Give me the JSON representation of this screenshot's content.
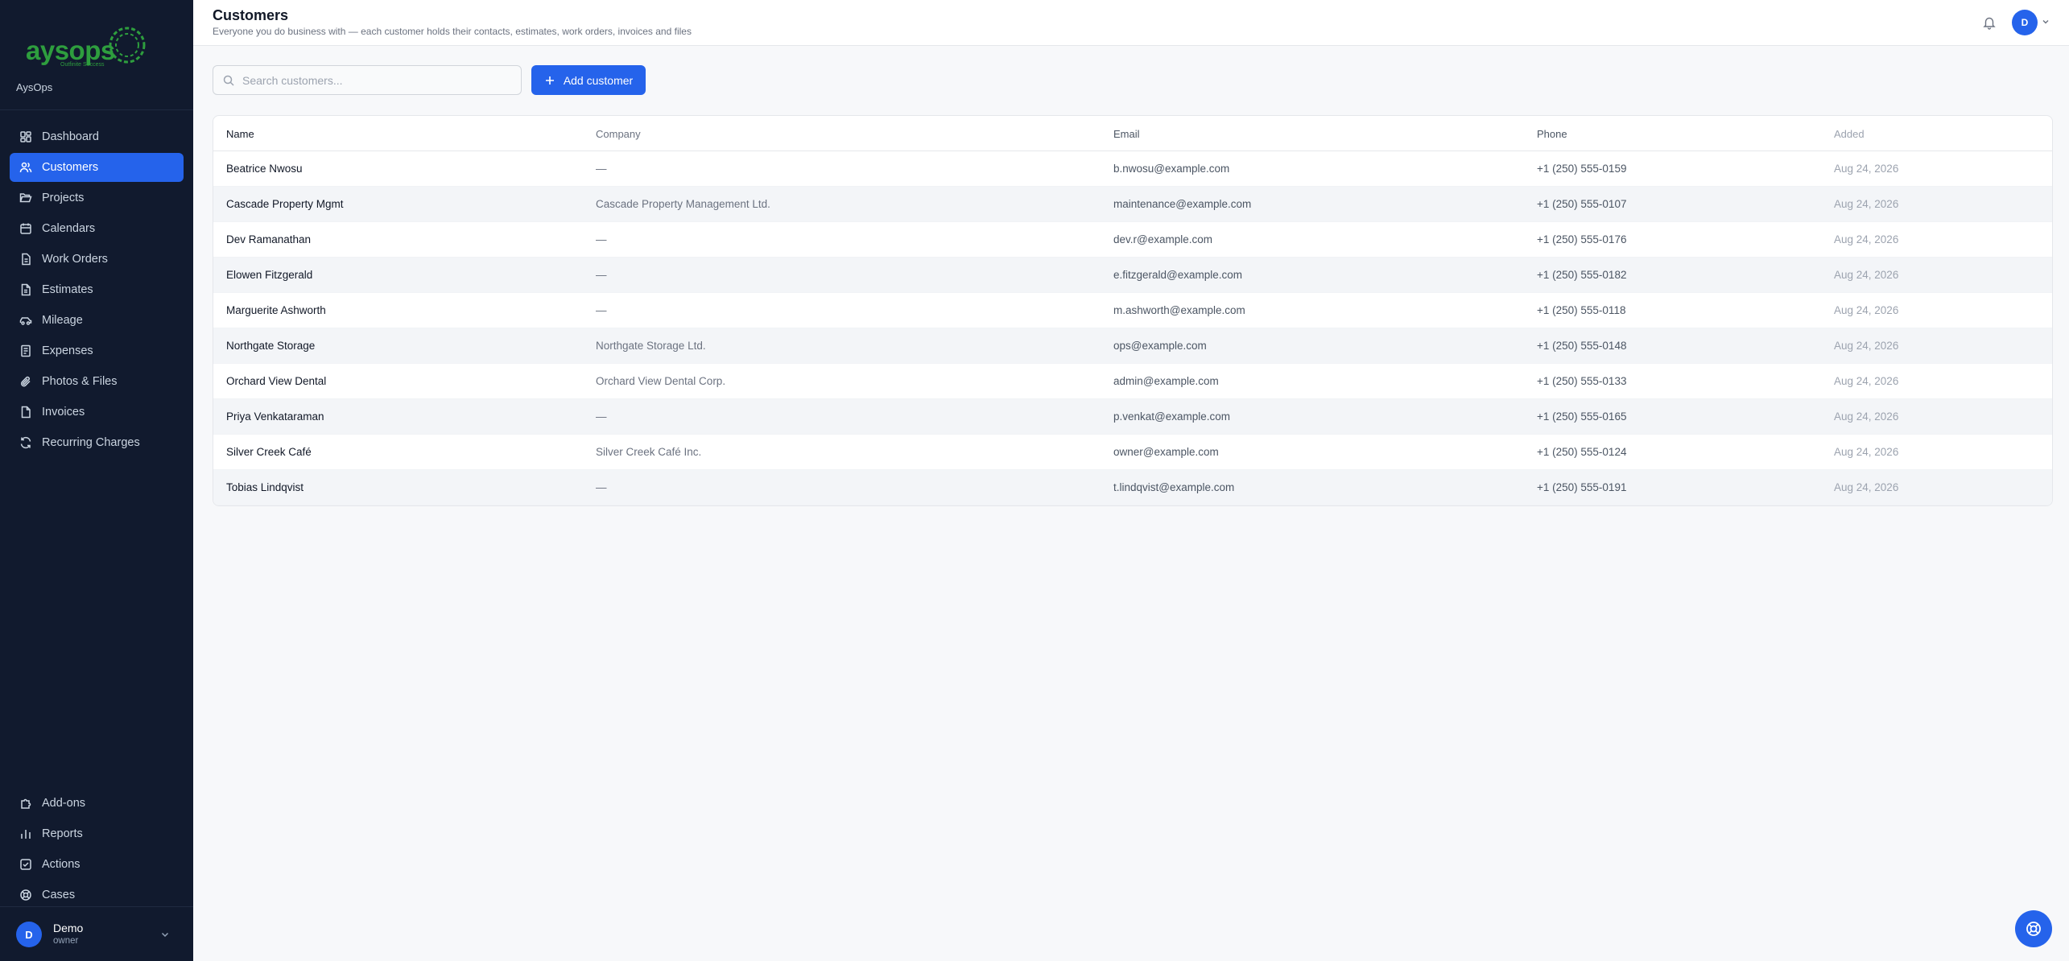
{
  "brand": {
    "logo_text": "aysops",
    "logo_tagline": "Outfinite Success",
    "org_name": "AysOps"
  },
  "sidebar": {
    "items": [
      {
        "label": "Dashboard",
        "icon": "dashboard-icon",
        "active": false
      },
      {
        "label": "Customers",
        "icon": "users-icon",
        "active": true
      },
      {
        "label": "Projects",
        "icon": "folder-icon",
        "active": false
      },
      {
        "label": "Calendars",
        "icon": "calendar-icon",
        "active": false
      },
      {
        "label": "Work Orders",
        "icon": "clipboard-icon",
        "active": false
      },
      {
        "label": "Estimates",
        "icon": "document-icon",
        "active": false
      },
      {
        "label": "Mileage",
        "icon": "car-icon",
        "active": false
      },
      {
        "label": "Expenses",
        "icon": "receipt-icon",
        "active": false
      },
      {
        "label": "Photos & Files",
        "icon": "paperclip-icon",
        "active": false
      },
      {
        "label": "Invoices",
        "icon": "invoice-icon",
        "active": false
      },
      {
        "label": "Recurring Charges",
        "icon": "refresh-icon",
        "active": false
      }
    ],
    "bottom_items": [
      {
        "label": "Add-ons",
        "icon": "puzzle-icon"
      },
      {
        "label": "Reports",
        "icon": "bar-chart-icon"
      },
      {
        "label": "Actions",
        "icon": "checkbox-icon"
      },
      {
        "label": "Cases",
        "icon": "lifebuoy-icon"
      }
    ],
    "user": {
      "initial": "D",
      "name": "Demo",
      "role": "owner"
    }
  },
  "header": {
    "title": "Customers",
    "subtitle": "Everyone you do business with — each customer holds their contacts, estimates, work orders, invoices and files",
    "avatar_initial": "D"
  },
  "toolbar": {
    "search_placeholder": "Search customers...",
    "add_label": "Add customer"
  },
  "table": {
    "columns": [
      "Name",
      "Company",
      "Email",
      "Phone",
      "Added"
    ],
    "rows": [
      {
        "name": "Beatrice Nwosu",
        "company": "—",
        "email": "b.nwosu@example.com",
        "phone": "+1 (250) 555-0159",
        "added": "Aug 24, 2026"
      },
      {
        "name": "Cascade Property Mgmt",
        "company": "Cascade Property Management Ltd.",
        "email": "maintenance@example.com",
        "phone": "+1 (250) 555-0107",
        "added": "Aug 24, 2026"
      },
      {
        "name": "Dev Ramanathan",
        "company": "—",
        "email": "dev.r@example.com",
        "phone": "+1 (250) 555-0176",
        "added": "Aug 24, 2026"
      },
      {
        "name": "Elowen Fitzgerald",
        "company": "—",
        "email": "e.fitzgerald@example.com",
        "phone": "+1 (250) 555-0182",
        "added": "Aug 24, 2026"
      },
      {
        "name": "Marguerite Ashworth",
        "company": "—",
        "email": "m.ashworth@example.com",
        "phone": "+1 (250) 555-0118",
        "added": "Aug 24, 2026"
      },
      {
        "name": "Northgate Storage",
        "company": "Northgate Storage Ltd.",
        "email": "ops@example.com",
        "phone": "+1 (250) 555-0148",
        "added": "Aug 24, 2026"
      },
      {
        "name": "Orchard View Dental",
        "company": "Orchard View Dental Corp.",
        "email": "admin@example.com",
        "phone": "+1 (250) 555-0133",
        "added": "Aug 24, 2026"
      },
      {
        "name": "Priya Venkataraman",
        "company": "—",
        "email": "p.venkat@example.com",
        "phone": "+1 (250) 555-0165",
        "added": "Aug 24, 2026"
      },
      {
        "name": "Silver Creek Café",
        "company": "Silver Creek Café Inc.",
        "email": "owner@example.com",
        "phone": "+1 (250) 555-0124",
        "added": "Aug 24, 2026"
      },
      {
        "name": "Tobias Lindqvist",
        "company": "—",
        "email": "t.lindqvist@example.com",
        "phone": "+1 (250) 555-0191",
        "added": "Aug 24, 2026"
      }
    ]
  },
  "colors": {
    "sidebar_bg": "#111a2e",
    "accent": "#2563eb",
    "brand_green": "#2e9e3e"
  }
}
